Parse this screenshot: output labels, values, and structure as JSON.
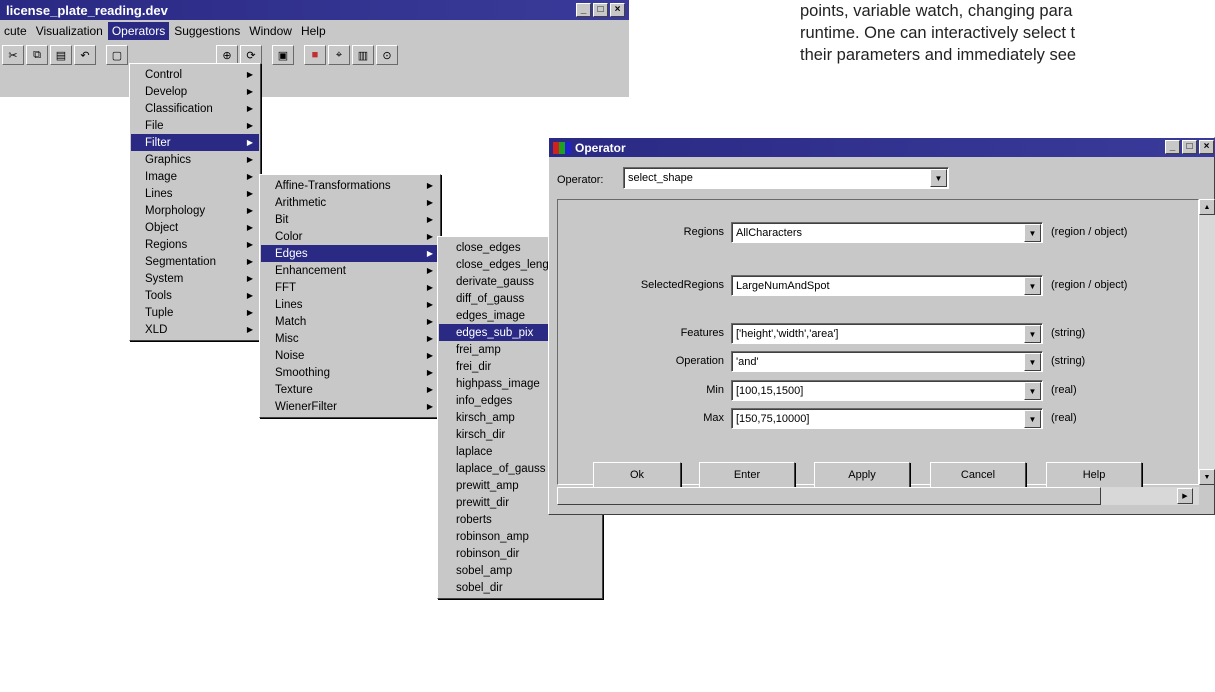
{
  "main_window": {
    "title": "license_plate_reading.dev",
    "window_buttons": [
      "_",
      "□",
      "×"
    ],
    "menubar": [
      "cute",
      "Visualization",
      "Operators",
      "Suggestions",
      "Window",
      "Help"
    ],
    "toolbar_icons": [
      "cut-icon",
      "copy-icon",
      "paste-icon",
      "undo-icon",
      "open-icon",
      "graph-icon",
      "inspect-icon",
      "image-icon",
      "palette-icon",
      "crosshair-icon",
      "histogram-icon",
      "zoom-icon"
    ]
  },
  "operators_menu": {
    "items": [
      {
        "label": "Control"
      },
      {
        "label": "Develop"
      },
      {
        "label": "Classification"
      },
      {
        "label": "File"
      },
      {
        "label": "Filter",
        "selected": true
      },
      {
        "label": "Graphics"
      },
      {
        "label": "Image"
      },
      {
        "label": "Lines"
      },
      {
        "label": "Morphology"
      },
      {
        "label": "Object"
      },
      {
        "label": "Regions"
      },
      {
        "label": "Segmentation"
      },
      {
        "label": "System"
      },
      {
        "label": "Tools"
      },
      {
        "label": "Tuple"
      },
      {
        "label": "XLD"
      }
    ]
  },
  "filter_menu": {
    "items": [
      {
        "label": "Affine-Transformations"
      },
      {
        "label": "Arithmetic"
      },
      {
        "label": "Bit"
      },
      {
        "label": "Color"
      },
      {
        "label": "Edges",
        "selected": true
      },
      {
        "label": "Enhancement"
      },
      {
        "label": "FFT"
      },
      {
        "label": "Lines"
      },
      {
        "label": "Match"
      },
      {
        "label": "Misc"
      },
      {
        "label": "Noise"
      },
      {
        "label": "Smoothing"
      },
      {
        "label": "Texture"
      },
      {
        "label": "WienerFilter"
      }
    ]
  },
  "edges_menu": {
    "items": [
      {
        "label": "close_edges"
      },
      {
        "label": "close_edges_length"
      },
      {
        "label": "derivate_gauss"
      },
      {
        "label": "diff_of_gauss"
      },
      {
        "label": "edges_image"
      },
      {
        "label": "edges_sub_pix",
        "selected": true
      },
      {
        "label": "frei_amp"
      },
      {
        "label": "frei_dir"
      },
      {
        "label": "highpass_image"
      },
      {
        "label": "info_edges"
      },
      {
        "label": "kirsch_amp"
      },
      {
        "label": "kirsch_dir"
      },
      {
        "label": "laplace"
      },
      {
        "label": "laplace_of_gauss"
      },
      {
        "label": "prewitt_amp"
      },
      {
        "label": "prewitt_dir"
      },
      {
        "label": "roberts"
      },
      {
        "label": "robinson_amp"
      },
      {
        "label": "robinson_dir"
      },
      {
        "label": "sobel_amp"
      },
      {
        "label": "sobel_dir"
      }
    ]
  },
  "operator_dialog": {
    "title": "Operator",
    "operator_label": "Operator:",
    "operator_value": "select_shape",
    "params": [
      {
        "label": "Regions",
        "value": "AllCharacters",
        "type": "(region / object)"
      },
      {
        "label": "SelectedRegions",
        "value": "LargeNumAndSpot",
        "type": "(region / object)"
      },
      {
        "label": "Features",
        "value": "['height','width','area']",
        "type": "(string)"
      },
      {
        "label": "Operation",
        "value": "'and'",
        "type": "(string)"
      },
      {
        "label": "Min",
        "value": "[100,15,1500]",
        "type": "(real)"
      },
      {
        "label": "Max",
        "value": "[150,75,10000]",
        "type": "(real)"
      }
    ],
    "buttons": {
      "ok": "Ok",
      "enter": "Enter",
      "apply": "Apply",
      "cancel": "Cancel",
      "help": "Help"
    }
  },
  "description": {
    "line1": "points, variable watch, changing para",
    "line2": "runtime. One can interactively select t",
    "line3": "their parameters and immediately see"
  },
  "colors": {
    "title_bar": "#2a2a84",
    "selection": "#2a2a84",
    "face": "#c8c8c8"
  }
}
